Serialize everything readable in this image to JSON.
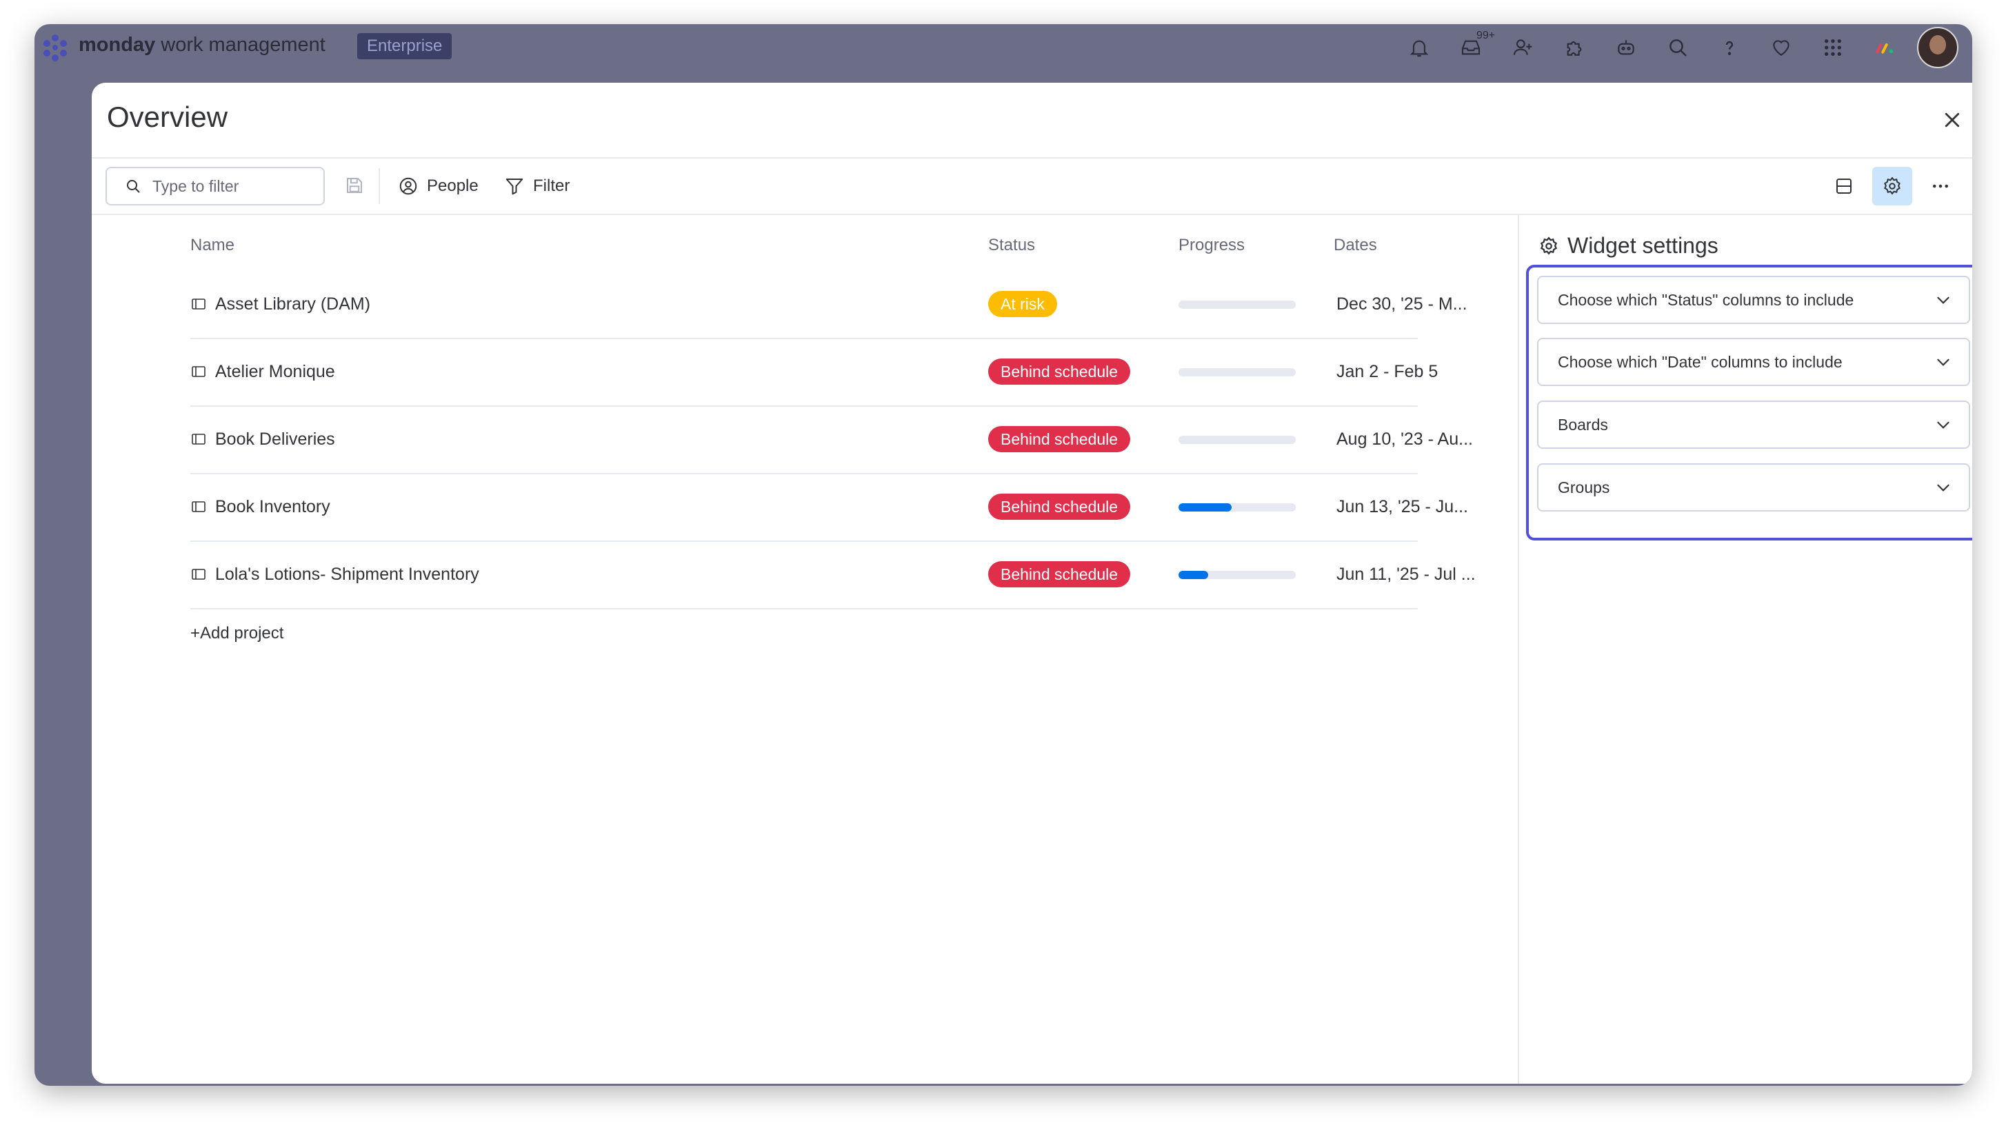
{
  "app": {
    "brand_bold": "monday",
    "brand_light": " work management",
    "plan_badge": "Enterprise",
    "notifications_badge": "99+"
  },
  "modal": {
    "title": "Overview"
  },
  "toolbar": {
    "search_placeholder": "Type to filter",
    "people_label": "People",
    "filter_label": "Filter"
  },
  "table": {
    "columns": [
      "Name",
      "Status",
      "Progress",
      "Dates"
    ],
    "rows": [
      {
        "name": "Asset Library (DAM)",
        "status": "At risk",
        "status_color": "#fdbc00",
        "progress": 0,
        "dates": "Dec 30, '25 - M..."
      },
      {
        "name": "Atelier Monique",
        "status": "Behind schedule",
        "status_color": "#df2f4a",
        "progress": 0,
        "dates": "Jan 2 - Feb 5"
      },
      {
        "name": "Book Deliveries",
        "status": "Behind schedule",
        "status_color": "#df2f4a",
        "progress": 0,
        "dates": "Aug 10, '23 - Au..."
      },
      {
        "name": "Book Inventory",
        "status": "Behind schedule",
        "status_color": "#df2f4a",
        "progress": 0.45,
        "dates": "Jun 13, '25 - Ju..."
      },
      {
        "name": "Lola's Lotions- Shipment Inventory",
        "status": "Behind schedule",
        "status_color": "#df2f4a",
        "progress": 0.25,
        "dates": "Jun 11, '25 - Jul ..."
      }
    ],
    "add_project_label": "+Add project"
  },
  "widget_settings": {
    "title": "Widget settings",
    "accordions": [
      "Choose which \"Status\" columns to include",
      "Choose which \"Date\" columns to include",
      "Boards",
      "Groups"
    ]
  },
  "colors": {
    "accent": "#0073ea",
    "highlight_border": "#5050d8",
    "at_risk": "#fdbc00",
    "behind_schedule": "#df2f4a"
  }
}
